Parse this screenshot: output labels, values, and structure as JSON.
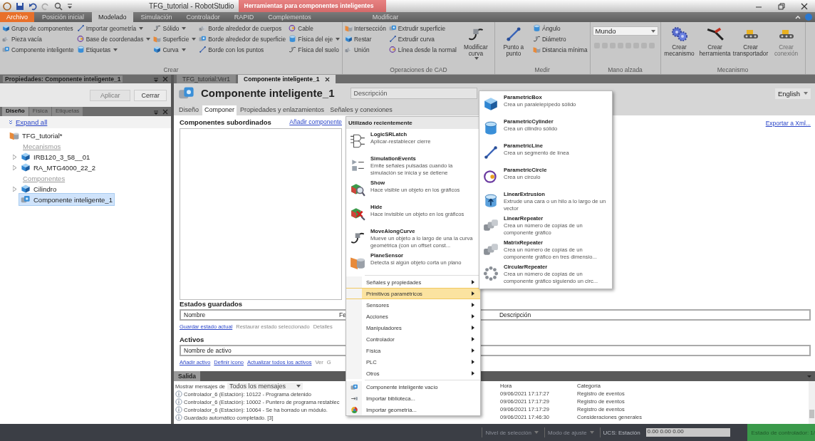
{
  "window": {
    "title": "TFG_tutorial - RobotStudio",
    "context_label": "Herramientas para componentes inteligentes"
  },
  "ribbon_tabs": [
    {
      "label": "Archivo",
      "kind": "file",
      "selected": false
    },
    {
      "label": "Posición inicial",
      "kind": "tab",
      "selected": false
    },
    {
      "label": "Modelado",
      "kind": "tab",
      "selected": true
    },
    {
      "label": "Simulación",
      "kind": "tab",
      "selected": false
    },
    {
      "label": "Controlador",
      "kind": "tab",
      "selected": false
    },
    {
      "label": "RAPID",
      "kind": "tab",
      "selected": false
    },
    {
      "label": "Complementos",
      "kind": "tab",
      "selected": false
    },
    {
      "label": "Modificar",
      "kind": "context",
      "selected": false
    }
  ],
  "ribbon_groups": [
    {
      "label": "Crear",
      "controls": [
        {
          "kind": "column",
          "items": [
            {
              "label": "Grupo de componentes",
              "dropdown": false
            },
            {
              "label": "Pieza vacía",
              "dropdown": false
            },
            {
              "label": "Componente inteligente",
              "dropdown": false
            }
          ]
        },
        {
          "kind": "column",
          "items": [
            {
              "label": "Importar geometría",
              "dropdown": true
            },
            {
              "label": "Base de coordenadas",
              "dropdown": true
            },
            {
              "label": "Etiquetas",
              "dropdown": true
            }
          ]
        },
        {
          "kind": "column",
          "items": [
            {
              "label": "Sólido",
              "dropdown": true
            },
            {
              "label": "Superficie",
              "dropdown": true
            },
            {
              "label": "Curva",
              "dropdown": true
            }
          ]
        },
        {
          "kind": "column",
          "items": [
            {
              "label": "Borde alrededor de cuerpos",
              "dropdown": false
            },
            {
              "label": "Borde alrededor de superficie",
              "dropdown": false
            },
            {
              "label": "Borde con los puntos",
              "dropdown": false
            }
          ]
        },
        {
          "kind": "column",
          "items": [
            {
              "label": "Cable",
              "dropdown": false
            },
            {
              "label": "Física del eje",
              "dropdown": true
            },
            {
              "label": "Física del suelo",
              "dropdown": false
            }
          ]
        }
      ]
    },
    {
      "label": "Operaciones de CAD",
      "controls": [
        {
          "kind": "column",
          "items": [
            {
              "label": "Intersección",
              "dropdown": false
            },
            {
              "label": "Restar",
              "dropdown": false
            },
            {
              "label": "Unión",
              "dropdown": false
            }
          ]
        },
        {
          "kind": "column",
          "items": [
            {
              "label": "Extrudir superficie",
              "dropdown": false
            },
            {
              "label": "Extrudir curva",
              "dropdown": false
            },
            {
              "label": "Línea desde la normal",
              "dropdown": false
            }
          ]
        },
        {
          "kind": "large",
          "label": "Modificar curva",
          "dropdown": true,
          "disabled": false
        }
      ]
    },
    {
      "label": "Medir",
      "controls": [
        {
          "kind": "large",
          "label": "Punto a punto",
          "dropdown": false,
          "disabled": false
        },
        {
          "kind": "column",
          "items": [
            {
              "label": "Ángulo",
              "dropdown": false
            },
            {
              "label": "Diámetro",
              "dropdown": false
            },
            {
              "label": "Distancia mínima",
              "dropdown": false
            }
          ]
        }
      ]
    },
    {
      "label": "Mano alzada",
      "controls": [
        {
          "kind": "combo",
          "value": "Mundo"
        }
      ]
    },
    {
      "label": "Mecanismo",
      "controls": [
        {
          "kind": "large",
          "label": "Crear mecanismo",
          "dropdown": false,
          "disabled": false
        },
        {
          "kind": "large",
          "label": "Crear herramienta",
          "dropdown": false,
          "disabled": false
        },
        {
          "kind": "large",
          "label": "Crear transportador",
          "dropdown": false,
          "disabled": false
        },
        {
          "kind": "large",
          "label": "Crear conexión",
          "dropdown": false,
          "disabled": true
        }
      ]
    }
  ],
  "properties_panel": {
    "title": "Propiedades: Componente inteligente_1",
    "buttons": [
      {
        "label": "Aplicar",
        "disabled": true
      },
      {
        "label": "Cerrar",
        "disabled": false
      }
    ],
    "tabs": [
      {
        "label": "Diseño",
        "selected": true
      },
      {
        "label": "Física",
        "selected": false
      },
      {
        "label": "Etiquetas",
        "selected": false
      }
    ],
    "expand_all": "Expand all",
    "tree": {
      "label": "TFG_tutorial*",
      "kind": "root",
      "children": [
        {
          "label": "Mecanismos",
          "kind": "category"
        },
        {
          "label": "IRB120_3_58__01",
          "kind": "group",
          "selected": false
        },
        {
          "label": "RA_MTG4000_22_2",
          "kind": "group",
          "selected": false
        },
        {
          "label": "Componentes",
          "kind": "category"
        },
        {
          "label": "Cilindro",
          "kind": "group",
          "selected": false
        },
        {
          "label": "Componente inteligente_1",
          "kind": "leaf",
          "selected": true
        }
      ]
    }
  },
  "document": {
    "tabs": [
      {
        "label": "TFG_tutorial:Ver1",
        "selected": false
      },
      {
        "label": "Componente inteligente_1",
        "selected": true
      }
    ],
    "title": "Componente inteligente_1",
    "description": {
      "placeholder": "Descripción"
    },
    "language": "English",
    "subtabs": [
      {
        "label": "Diseño",
        "selected": false
      },
      {
        "label": "Componer",
        "selected": true
      },
      {
        "label": "Propiedades y enlazamientos",
        "selected": false
      },
      {
        "label": "Señales y conexiones",
        "selected": false
      }
    ],
    "children_heading": "Componentes subordinados",
    "add_component": "Añadir componente",
    "export": "Exportar a Xml...",
    "saved_states": {
      "heading": "Estados guardados",
      "columns": [
        "Nombre",
        "Fe",
        "Descripción"
      ],
      "actions": [
        {
          "label": "Guardar estado actual",
          "disabled": false
        },
        {
          "label": "Restaurar estado seleccionado",
          "disabled": true
        },
        {
          "label": "Detalles",
          "disabled": true
        }
      ]
    },
    "assets": {
      "heading": "Activos",
      "columns": [
        "Nombre de activo"
      ],
      "actions": [
        {
          "label": "Añadir activo",
          "disabled": false
        },
        {
          "label": "Definir icono",
          "disabled": false
        },
        {
          "label": "Actualizar todos los activos",
          "disabled": false
        },
        {
          "label": "Ver",
          "disabled": true
        },
        {
          "label": "G",
          "disabled": true
        }
      ]
    }
  },
  "output": {
    "tab": "Salida",
    "filter_label": "Mostrar mensajes de",
    "filter_value": "Todos los mensajes",
    "columns": [
      "Hora",
      "Categoría"
    ],
    "messages": [
      {
        "text": "Controlador_6 (Estación): 10122 - Programa detenido",
        "time": "09/06/2021 17:17:27",
        "category": "Registro de eventos"
      },
      {
        "text": "Controlador_6 (Estación): 10002 - Puntero de programa restablec",
        "time": "09/06/2021 17:17:29",
        "category": "Registro de eventos"
      },
      {
        "text": "Controlador_6 (Estación): 10064 - Se ha borrado un módulo.",
        "time": "09/06/2021 17:17:29",
        "category": "Registro de eventos"
      },
      {
        "text": "Guardado automático completado. [3]",
        "time": "09/06/2021 17:46:30",
        "category": "Consideraciones generales"
      }
    ]
  },
  "context_menu": {
    "header": "Utilizado recientemente",
    "recent": [
      {
        "name": "LogicSRLatch",
        "description": "Aplicar-restablecer cierre"
      },
      {
        "name": "SimulationEvents",
        "description": "Emite señales pulsadas cuando la simulación se inicia y se detiene"
      },
      {
        "name": "Show",
        "description": "Hace visible un objeto en los gráficos"
      },
      {
        "name": "Hide",
        "description": "Hace invisible un objeto en los gráficos"
      },
      {
        "name": "MoveAlongCurve",
        "description": "Mueve un objeto a lo largo de una la curva geométrica (con un offset const..."
      },
      {
        "name": "PlaneSensor",
        "description": "Detecta si algún objeto corta un plano"
      }
    ],
    "categories": [
      {
        "label": "Señales y propiedades",
        "selected": false
      },
      {
        "label": "Primitivos paramétricos",
        "selected": true
      },
      {
        "label": "Sensores",
        "selected": false
      },
      {
        "label": "Acciones",
        "selected": false
      },
      {
        "label": "Manipuladores",
        "selected": false
      },
      {
        "label": "Controlador",
        "selected": false
      },
      {
        "label": "Física",
        "selected": false
      },
      {
        "label": "PLC",
        "selected": false
      },
      {
        "label": "Otros",
        "selected": false
      }
    ],
    "actions": [
      {
        "label": "Componente inteligente vacío"
      },
      {
        "label": "Importar biblioteca..."
      },
      {
        "label": "Importar geometría..."
      }
    ]
  },
  "submenu": {
    "items": [
      {
        "name": "ParametricBox",
        "description": "Crea un paralelepípedo sólido"
      },
      {
        "name": "ParametricCylinder",
        "description": "Crea un cilindro sólido"
      },
      {
        "name": "ParametricLine",
        "description": "Crea un segmento de línea"
      },
      {
        "name": "ParametricCircle",
        "description": "Crea un círculo"
      },
      {
        "name": "LinearExtrusion",
        "description": "Extrude una cara o un hilo a lo largo de un vector"
      },
      {
        "name": "LinearRepeater",
        "description": "Crea un número de copias de un componente gráfico"
      },
      {
        "name": "MatrixRepeater",
        "description": "Crea un número de copias de un componente gráfico en tres dimensio..."
      },
      {
        "name": "CircularRepeater",
        "description": "Crea un número de copias de un componente gráfico siguiendo un circ..."
      }
    ]
  },
  "status_bar": {
    "selection_level": "Nivel de selección",
    "snap_mode": "Modo de ajuste",
    "ucs": "UCS: Estación",
    "coordinates": "0.00 0.00 0.00",
    "controller_state": "Estado de controlador: 1/"
  }
}
